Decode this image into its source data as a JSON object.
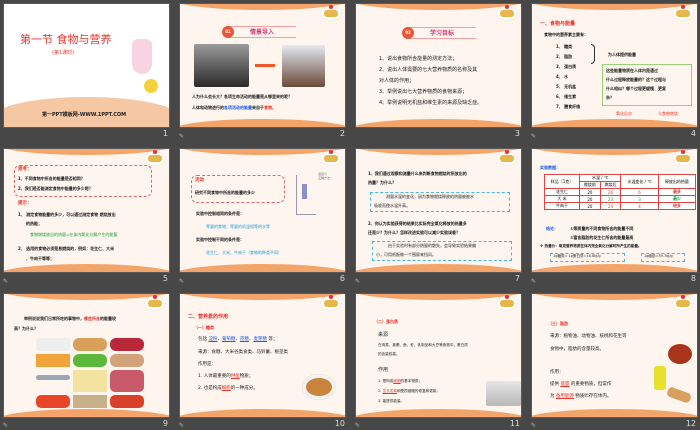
{
  "slide_numbers": [
    "1",
    "2",
    "3",
    "4",
    "5",
    "6",
    "7",
    "8",
    "9",
    "10",
    "11",
    "12"
  ],
  "notes_icon": "notes-icon",
  "s1": {
    "title": "第一节 食物与营养",
    "subtitle": "(第1课时)",
    "footer": "第一PPT模板网-WWW.1PPT.COM"
  },
  "s2": {
    "badge": "01",
    "heading": "情景导入",
    "q": "人为什么会长大？各项生命活动的能量是从哪里来的呢？",
    "a1": "人体和动物进行的",
    "a2": "各项活动的能量",
    "a3": "来自于",
    "a4": "食物。"
  },
  "s3": {
    "badge": "02",
    "heading": "学习目标",
    "items": [
      "1、说出食物所含能量的测定方法；",
      "2、说出人体需要的七大营养物质的名称及其",
      "对人体的作用；",
      "3、举例说出七大营养物质的食物来源；",
      "4、举例说明无机盐和维生素的来源及缺乏症。"
    ]
  },
  "s4": {
    "heading": "一、食物与能量",
    "intro": "食物中的营养素主要有：",
    "list": [
      "1、 糖类",
      "2、 脂肪",
      "3、 蛋白质",
      "4、 水",
      "5、 无机盐",
      "6、 维生素",
      "7、 膳食纤维"
    ],
    "brace_note": "为人体提供能量",
    "box": [
      "这些能量物质在人体内是通过",
      "什么过程释放能量的？这个过程与",
      "什么相似？哪个过程更缓慢、更复",
      "杂？"
    ],
    "link1": "氧化反应",
    "link2": "与食物燃烧"
  },
  "s5": {
    "think": "思考：",
    "q1": "1、不同食物中所含的能量是否相同？",
    "q2": "2、我们是否能测定食物中能量的多少呢？",
    "hint": "提示：",
    "h1a": "1、 测定食物能量的多少，可以通过测定食物 燃烧放出",
    "h1b": "的热能；",
    "formula": "食物燃烧放出的热量=在体内氧化分解产生的能量",
    "h2a": "2、 选用的食物必须是易燃烧的，例如：花生仁、大米",
    "h2b": "、牛肉干等等；"
  },
  "s6": {
    "act": "活动",
    "act_text": "研究不同食物中所含的能量的多少",
    "apparatus": [
      "温度计",
      "正确方法"
    ],
    "c1": "实验中控制相同的条件是：",
    "c1v": "等量的食物、等量的初温相等的水等",
    "c2": "实验中控制不同的条件是：",
    "c2v": "花生仁、大米、牛肉干（食物的种类不同）"
  },
  "s7": {
    "q1a": "1、我们通过观察和测量什么来判断食物燃烧时所放出的",
    "q1b": "热量？为什么？",
    "a1a": "测量水温的变化，因为食物燃烧释放的热量被被水",
    "a1b": "吸收而使水温升高。",
    "q2a": "2、你认为实验获得的结果比实际完全氧化释放的热量多",
    "q2b": "还是少？为什么？怎样改进实验可以减少实验误差？",
    "a2a": "由于实验时有部分热量的散失，会导致实验结果偏",
    "a2b": "小，可用纸板做一个围屏来挡风。"
  },
  "s8": {
    "heading": "实验数据：",
    "table": {
      "headers": [
        "样品（1克）",
        "水温 / ℃",
        "水温变化 / ℃",
        "释放出的热量"
      ],
      "sub": [
        "燃烧前",
        "燃烧后"
      ],
      "rows": [
        [
          "花生仁",
          "20",
          "26",
          "6",
          "最多"
        ],
        [
          "大 米",
          "20",
          "23",
          "3",
          "最少"
        ],
        [
          "牛肉干",
          "20",
          "24",
          "4",
          "较多"
        ]
      ]
    },
    "concl": "结论：",
    "c1": "①等质量的不同食物所含的能量不同",
    "c2": "②富含脂肪的花生仁所含的能量最高",
    "heat": "❖ 热量价：每克营养物质在体内完全氧化分解时所产生的能量。",
    "v1": "1g糖类= 1g蛋白质=16.8kJ/g",
    "v2": "1g脂肪=39.7kJ/g"
  },
  "s9": {
    "q1": "举例说说我们日常所吃的事物中，",
    "q2": "哪些所含",
    "q3": "的能量较",
    "q4": "高？为什么？"
  },
  "s10": {
    "heading": "二、营养素的作用",
    "sub": "（一）糖类",
    "inc": "包括",
    "items": [
      "淀粉",
      "葡萄糖",
      "蔗糖",
      "麦芽糖"
    ],
    "etc": "等；",
    "src": "来源：食糖、大米谷类食类、马铃薯、根茎类",
    "role": "作用是：",
    "r1a": "1. 人体最重要的",
    "r1b": "供能",
    "r1c": "物质；",
    "r2a": "2. 也是构成",
    "r2b": "细胞",
    "r2c": "的一种成分。"
  },
  "s11": {
    "heading": "（二）蛋白质",
    "src": "来源",
    "src_text1": "在肉类、禽蛋、鱼、虾、乳制品和大豆等食物中，蛋白质",
    "src_text2": "的含量较高。",
    "role": "作用",
    "r1a": "1. 是构成",
    "r1b": "细胞",
    "r1c": "的基本物质；",
    "r2a": "2.",
    "r2b": "生长发育",
    "r2c": "和受损细胞的修复和更新。",
    "r3": "3. 能提供能量。"
  },
  "s12": {
    "heading": "（三）脂肪",
    "src1": "来源：植物油、动物油、核桃和花生等",
    "src2": "食物中，脂肪的含量较高。",
    "role": "作用：",
    "p1a": "提供",
    "p1b": "能量",
    "p1c": "的重要物质，但常作",
    "p2a": "为",
    "p2b": "备用能源",
    "p2c": "物质贮存在体内。"
  }
}
